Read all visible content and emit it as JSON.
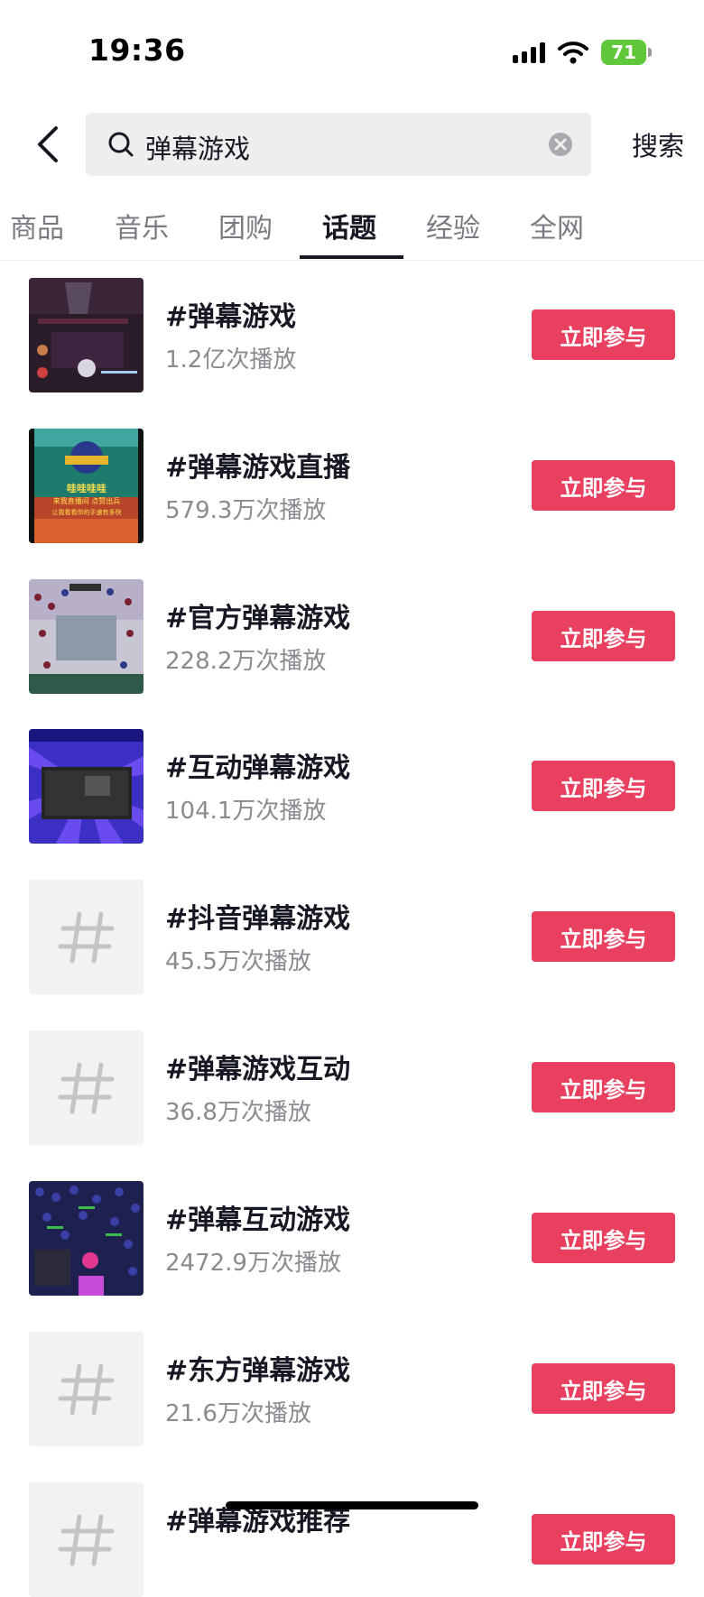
{
  "status_bar": {
    "time": "19:36",
    "battery": "71",
    "icons": [
      "signal-icon",
      "wifi-icon",
      "battery-icon"
    ]
  },
  "search": {
    "query": "弹幕游戏",
    "button_label": "搜索",
    "icons": [
      "back-arrow-icon",
      "search-icon",
      "clear-icon"
    ]
  },
  "tabs": [
    {
      "label": "商品",
      "active": false
    },
    {
      "label": "音乐",
      "active": false
    },
    {
      "label": "团购",
      "active": false
    },
    {
      "label": "话题",
      "active": true
    },
    {
      "label": "经验",
      "active": false
    },
    {
      "label": "全网",
      "active": false
    }
  ],
  "topics": [
    {
      "title": "#弹幕游戏",
      "count": "1.2亿次播放",
      "button": "立即参与",
      "thumb": "dark-game-scene"
    },
    {
      "title": "#弹幕游戏直播",
      "count": "579.3万次播放",
      "button": "立即参与",
      "thumb": "live-arena"
    },
    {
      "title": "#官方弹幕游戏",
      "count": "228.2万次播放",
      "button": "立即参与",
      "thumb": "crowd-battle"
    },
    {
      "title": "#互动弹幕游戏",
      "count": "104.1万次播放",
      "button": "立即参与",
      "thumb": "purple-screen"
    },
    {
      "title": "#抖音弹幕游戏",
      "count": "45.5万次播放",
      "button": "立即参与",
      "thumb": "hash-placeholder"
    },
    {
      "title": "#弹幕游戏互动",
      "count": "36.8万次播放",
      "button": "立即参与",
      "thumb": "hash-placeholder"
    },
    {
      "title": "#弹幕互动游戏",
      "count": "2472.9万次播放",
      "button": "立即参与",
      "thumb": "army-scene"
    },
    {
      "title": "#东方弹幕游戏",
      "count": "21.6万次播放",
      "button": "立即参与",
      "thumb": "hash-placeholder"
    },
    {
      "title": "#弹幕游戏推荐",
      "count": "",
      "button": "立即参与",
      "thumb": "hash-placeholder"
    }
  ],
  "thumb_texts": {
    "live_arena": [
      "哇哇哇哇",
      "来我直播间 点赞出兵",
      "让我看看你的手速有多快"
    ]
  },
  "colors": {
    "accent": "#ea4060",
    "text_primary": "#161823",
    "text_secondary": "#8a8b91",
    "search_bg": "#eeeeef"
  }
}
